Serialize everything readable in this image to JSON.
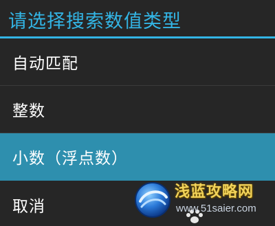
{
  "dialog": {
    "title": "请选择搜索数值类型",
    "accent_color": "#33b5e5",
    "selected_color": "#2e8fae",
    "options": [
      {
        "label": "自动匹配",
        "selected": false
      },
      {
        "label": "整数",
        "selected": false
      },
      {
        "label": "小数（浮点数）",
        "selected": true
      },
      {
        "label": "取消",
        "selected": false
      }
    ]
  },
  "watermark": {
    "name": "浅蓝攻略网",
    "url": "www.51saier.com",
    "logo_icon": "blue-globe-swirl-icon"
  }
}
